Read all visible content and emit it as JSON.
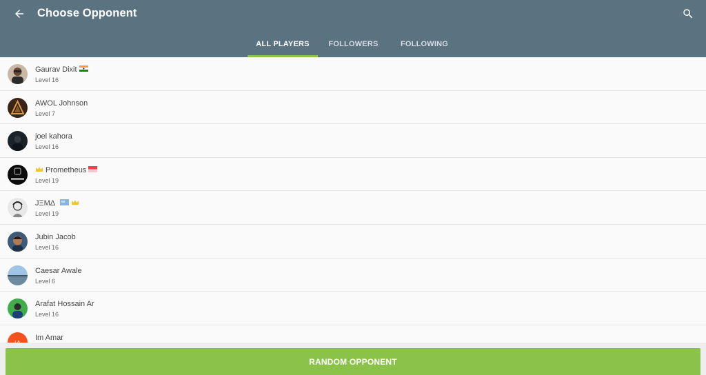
{
  "header": {
    "title": "Choose Opponent",
    "back_icon": "arrow-left-icon",
    "search_icon": "search-icon",
    "background_color": "#5b7281"
  },
  "tabs": [
    {
      "label": "ALL PLAYERS",
      "active": true
    },
    {
      "label": "FOLLOWERS",
      "active": false
    },
    {
      "label": "FOLLOWING",
      "active": false
    }
  ],
  "accent_color": "#8bc34a",
  "players": [
    {
      "name": "Gaurav Dixit",
      "level": "Level 16",
      "badges": [
        "india-flag-icon"
      ]
    },
    {
      "name": "AWOL Johnson",
      "level": "Level 7",
      "badges": []
    },
    {
      "name": "joel kahora",
      "level": "Level 16",
      "badges": []
    },
    {
      "name": "Prometheus",
      "level": "Level 19",
      "prefix_badges": [
        "crown-icon"
      ],
      "badges": [
        "flag-icon"
      ]
    },
    {
      "name": "JΞMΔ",
      "level": "Level 19",
      "badges": [
        "flag-icon",
        "crown-icon"
      ]
    },
    {
      "name": "Jubin Jacob",
      "level": "Level 16",
      "badges": []
    },
    {
      "name": "Caesar Awale",
      "level": "Level 6",
      "badges": []
    },
    {
      "name": "Arafat Hossain Ar",
      "level": "Level 16",
      "badges": []
    },
    {
      "name": "Im Amar",
      "level": "",
      "badges": []
    }
  ],
  "random_button": {
    "label": "RANDOM OPPONENT"
  }
}
